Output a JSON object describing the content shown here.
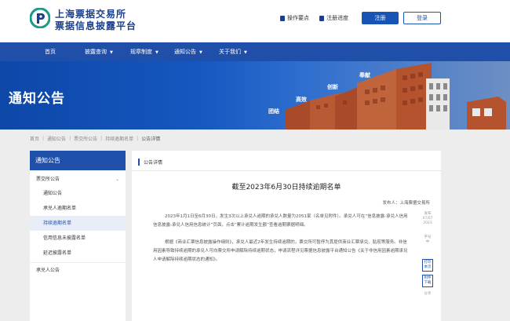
{
  "header": {
    "org_name_line1": "上海票据交易所",
    "org_name_line2": "票据信息披露平台",
    "links": [
      {
        "label": "操作要点"
      },
      {
        "label": "注册进度"
      }
    ],
    "register_label": "注册",
    "login_label": "登录"
  },
  "nav": {
    "items": [
      {
        "label": "首页",
        "caret": false
      },
      {
        "label": "披露查询",
        "caret": true
      },
      {
        "label": "规章制度",
        "caret": true
      },
      {
        "label": "通知公告",
        "caret": true
      },
      {
        "label": "关于我们",
        "caret": true
      }
    ]
  },
  "banner": {
    "title": "通知公告",
    "words": [
      "团结",
      "高效",
      "创新",
      "奉献"
    ]
  },
  "breadcrumb": [
    "首页",
    "通知公告",
    "票交所公告",
    "持续逾期名单",
    "公告详情"
  ],
  "sidebar": {
    "title": "通知公告",
    "items": [
      {
        "label": "票交所公告",
        "level": 1,
        "chevron": "⌄"
      },
      {
        "label": "通知公告",
        "level": 2
      },
      {
        "label": "承兑人逾期名单",
        "level": 2
      },
      {
        "label": "持续逾期名单",
        "level": 2,
        "active": true
      },
      {
        "label": "信用信息未披露名单",
        "level": 2
      },
      {
        "label": "延迟披露名单",
        "level": 2
      },
      {
        "label": "承兑人公告",
        "level": 1,
        "chevron": ""
      }
    ]
  },
  "main": {
    "tab_label": "公告详情",
    "title": "截至2023年6月30日持续逾期名单",
    "publisher": "发布人：上海票据交易所",
    "paragraphs": [
      "2023年1月1日至6月30日，发生3次以上承兑人逾期的承兑人数量为2051家（名单见附件）。承兑人可在“信息披露-承兑人信用信息披露-承兑人信用信息统计”页面，点击“累计逾期发生额”查看逾期票据明细。",
      "根据《商业汇票信息披露操作细则》，承兑人最近2年发生持续逾期的，票交所可暂停为其提供商业汇票承兑、贴现等服务。非信用因素导致持续逾期的承兑人可向票交所申请解除持续逾期状态，申请流程详见票据信息披露平台通知公告《关于非信用因素逾期承兑人申请解除持续逾期状态的通知》。"
    ]
  },
  "tools": {
    "date_label": "发布",
    "date_value": "07/07 2023",
    "font_label": "字号",
    "font_value": "中",
    "print_label": "打印 本页",
    "attach_label": "附件 下载",
    "share_label": "分享"
  },
  "colors": {
    "primary": "#1f4fa8",
    "button_blue": "#1754b4",
    "logo_text": "#1a3f8c",
    "brick": "#b5532f"
  }
}
